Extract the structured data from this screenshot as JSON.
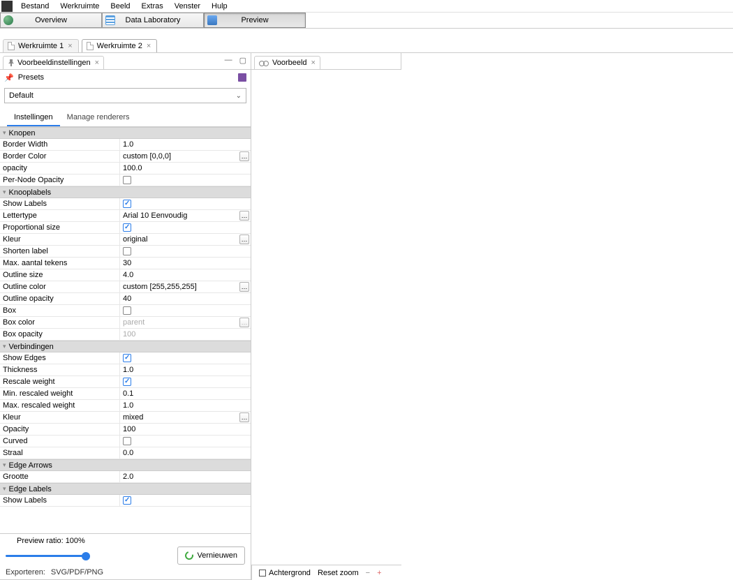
{
  "menu": {
    "items": [
      "Bestand",
      "Werkruimte",
      "Beeld",
      "Extras",
      "Venster",
      "Hulp"
    ]
  },
  "modes": {
    "overview": "Overview",
    "datalab": "Data Laboratory",
    "preview": "Preview",
    "active": "preview"
  },
  "workspaces": {
    "tabs": [
      {
        "label": "Werkruimte 1",
        "active": false
      },
      {
        "label": "Werkruimte 2",
        "active": true
      }
    ]
  },
  "left_panel": {
    "tab": "Voorbeeldinstellingen",
    "presets_label": "Presets",
    "preset_selected": "Default",
    "inner_tabs": {
      "settings": "Instellingen",
      "manage": "Manage renderers",
      "active": "settings"
    },
    "sections": {
      "knopen": {
        "title": "Knopen",
        "border_width_k": "Border Width",
        "border_width_v": "1.0",
        "border_color_k": "Border Color",
        "border_color_v": "custom [0,0,0]",
        "opacity_k": "opacity",
        "opacity_v": "100.0",
        "per_node_opacity_k": "Per-Node Opacity",
        "per_node_opacity_v": false
      },
      "knooplabels": {
        "title": "Knooplabels",
        "show_labels_k": "Show Labels",
        "show_labels_v": true,
        "lettertype_k": "Lettertype",
        "lettertype_v": "Arial 10 Eenvoudig",
        "prop_size_k": "Proportional size",
        "prop_size_v": true,
        "kleur_k": "Kleur",
        "kleur_v": "original",
        "shorten_k": "Shorten label",
        "shorten_v": false,
        "max_chars_k": "Max. aantal tekens",
        "max_chars_v": "30",
        "outline_size_k": "Outline size",
        "outline_size_v": "4.0",
        "outline_color_k": "Outline color",
        "outline_color_v": "custom [255,255,255]",
        "outline_opacity_k": "Outline opacity",
        "outline_opacity_v": "40",
        "box_k": "Box",
        "box_v": false,
        "box_color_k": "Box color",
        "box_color_v": "parent",
        "box_opacity_k": "Box opacity",
        "box_opacity_v": "100"
      },
      "verbindingen": {
        "title": "Verbindingen",
        "show_edges_k": "Show Edges",
        "show_edges_v": true,
        "thickness_k": "Thickness",
        "thickness_v": "1.0",
        "rescale_k": "Rescale weight",
        "rescale_v": true,
        "min_res_k": "Min. rescaled weight",
        "min_res_v": "0.1",
        "max_res_k": "Max. rescaled weight",
        "max_res_v": "1.0",
        "kleur_k": "Kleur",
        "kleur_v": "mixed",
        "opacity_k": "Opacity",
        "opacity_v": "100",
        "curved_k": "Curved",
        "curved_v": false,
        "straal_k": "Straal",
        "straal_v": "0.0"
      },
      "edge_arrows": {
        "title": "Edge Arrows",
        "grootte_k": "Grootte",
        "grootte_v": "2.0"
      },
      "edge_labels": {
        "title": "Edge Labels",
        "show_labels_k": "Show Labels",
        "show_labels_v": true
      }
    },
    "footer": {
      "ratio_label": "Preview ratio:  100%",
      "slider_pct": 100,
      "refresh": "Vernieuwen",
      "export_label": "Exporteren:",
      "export_fmt": "SVG/PDF/PNG"
    }
  },
  "right_panel": {
    "tab": "Voorbeeld",
    "status": {
      "background": "Achtergrond",
      "reset_zoom": "Reset zoom",
      "minus": "−",
      "plus": "+"
    }
  }
}
